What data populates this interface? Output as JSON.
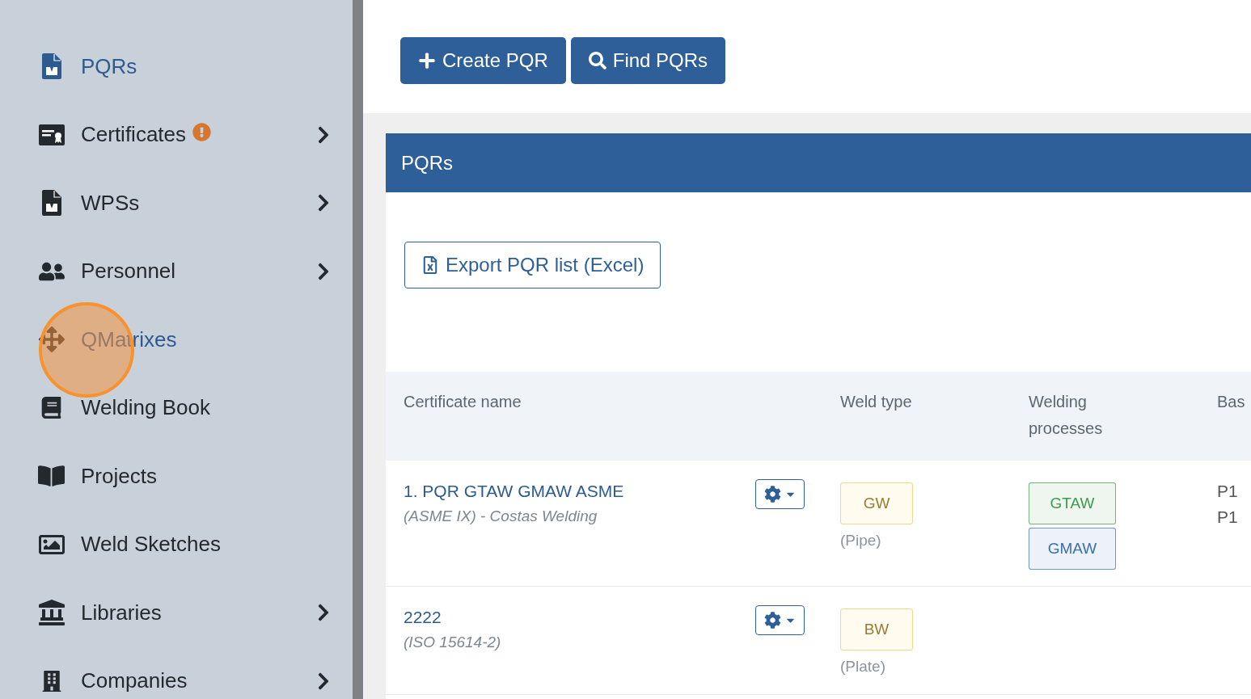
{
  "sidebar": {
    "items": [
      {
        "label": "PQRs",
        "selected": true,
        "clicked": false,
        "submenu": false,
        "alert": false
      },
      {
        "label": "Certificates",
        "selected": false,
        "clicked": false,
        "submenu": true,
        "alert": true
      },
      {
        "label": "WPSs",
        "selected": false,
        "clicked": false,
        "submenu": true,
        "alert": false
      },
      {
        "label": "Personnel",
        "selected": false,
        "clicked": false,
        "submenu": true,
        "alert": false
      },
      {
        "label": "QMatrixes",
        "selected": false,
        "clicked": true,
        "submenu": false,
        "alert": false
      },
      {
        "label": "Welding Book",
        "selected": false,
        "clicked": false,
        "submenu": false,
        "alert": false
      },
      {
        "label": "Projects",
        "selected": false,
        "clicked": false,
        "submenu": false,
        "alert": false
      },
      {
        "label": "Weld Sketches",
        "selected": false,
        "clicked": false,
        "submenu": false,
        "alert": false
      },
      {
        "label": "Libraries",
        "selected": false,
        "clicked": false,
        "submenu": true,
        "alert": false
      },
      {
        "label": "Companies",
        "selected": false,
        "clicked": false,
        "submenu": true,
        "alert": false
      }
    ]
  },
  "page": {
    "actions": [
      {
        "kind": "create",
        "label": "Create PQR"
      },
      {
        "kind": "find",
        "label": "Find PQRs"
      }
    ]
  },
  "panel": {
    "title": "PQRs",
    "export_button": "Export PQR list (Excel)",
    "table": {
      "columns": [
        "Certificate name",
        "Weld type",
        "Welding processes",
        "Bas"
      ],
      "rows": [
        {
          "name": "1. PQR GTAW GMAW ASME",
          "subtitle": "(ASME IX) - Costas Welding",
          "weld_type": {
            "label": "GW",
            "note": "(Pipe)"
          },
          "processes": [
            {
              "label": "GTAW",
              "color": "#3d9a4c"
            },
            {
              "label": "GMAW",
              "color": "#3a6fb0"
            }
          ],
          "base": [
            "P1",
            "P1"
          ]
        },
        {
          "name": "2222",
          "subtitle": "(ISO 15614-2)",
          "weld_type": {
            "label": "BW",
            "note": "(Plate)"
          }
        }
      ]
    }
  }
}
